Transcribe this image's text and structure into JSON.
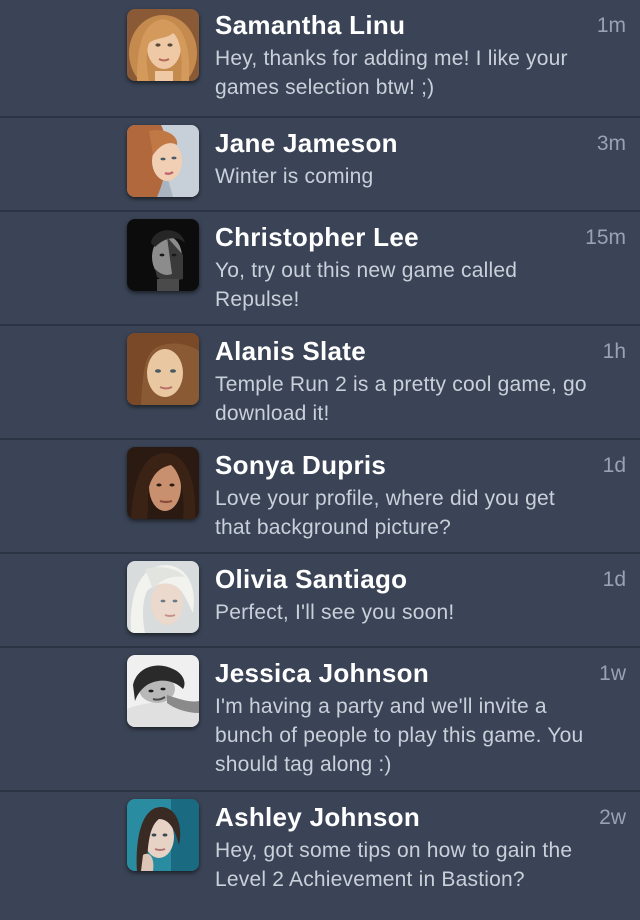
{
  "messages": [
    {
      "name": "Samantha Linu",
      "time": "1m",
      "text": "Hey, thanks for adding me! I like your games selection btw! ;)",
      "avatar": "portrait-photo-blonde-woman"
    },
    {
      "name": "Jane Jameson",
      "time": "3m",
      "text": "Winter is coming",
      "avatar": "portrait-photo-woman-reddish-hair"
    },
    {
      "name": "Christopher Lee",
      "time": "15m",
      "text": "Yo, try out this new game called Repulse!",
      "avatar": "portrait-photo-man-black-and-white"
    },
    {
      "name": "Alanis Slate",
      "time": "1h",
      "text": "Temple Run 2 is a pretty cool game, go download it!",
      "avatar": "portrait-photo-woman-brown-hair"
    },
    {
      "name": "Sonya Dupris",
      "time": "1d",
      "text": "Love your profile, where did you get that background picture?",
      "avatar": "portrait-photo-woman-dark-hair"
    },
    {
      "name": "Olivia Santiago",
      "time": "1d",
      "text": "Perfect, I'll see you soon!",
      "avatar": "portrait-photo-woman-platinum-hair"
    },
    {
      "name": "Jessica Johnson",
      "time": "1w",
      "text": "I'm having a party and we'll invite a bunch of people to play this game. You should tag along :)",
      "avatar": "portrait-photo-woman-black-and-white"
    },
    {
      "name": "Ashley Johnson",
      "time": "2w",
      "text": "Hey, got some tips on how to gain the Level 2 Achievement in Bastion?",
      "avatar": "portrait-photo-woman-teal-tone"
    }
  ],
  "colors": {
    "background": "#3a4456",
    "divider": "#2d3544",
    "name": "#ffffff",
    "message": "#c9d0da",
    "timestamp": "#98a2b3"
  }
}
